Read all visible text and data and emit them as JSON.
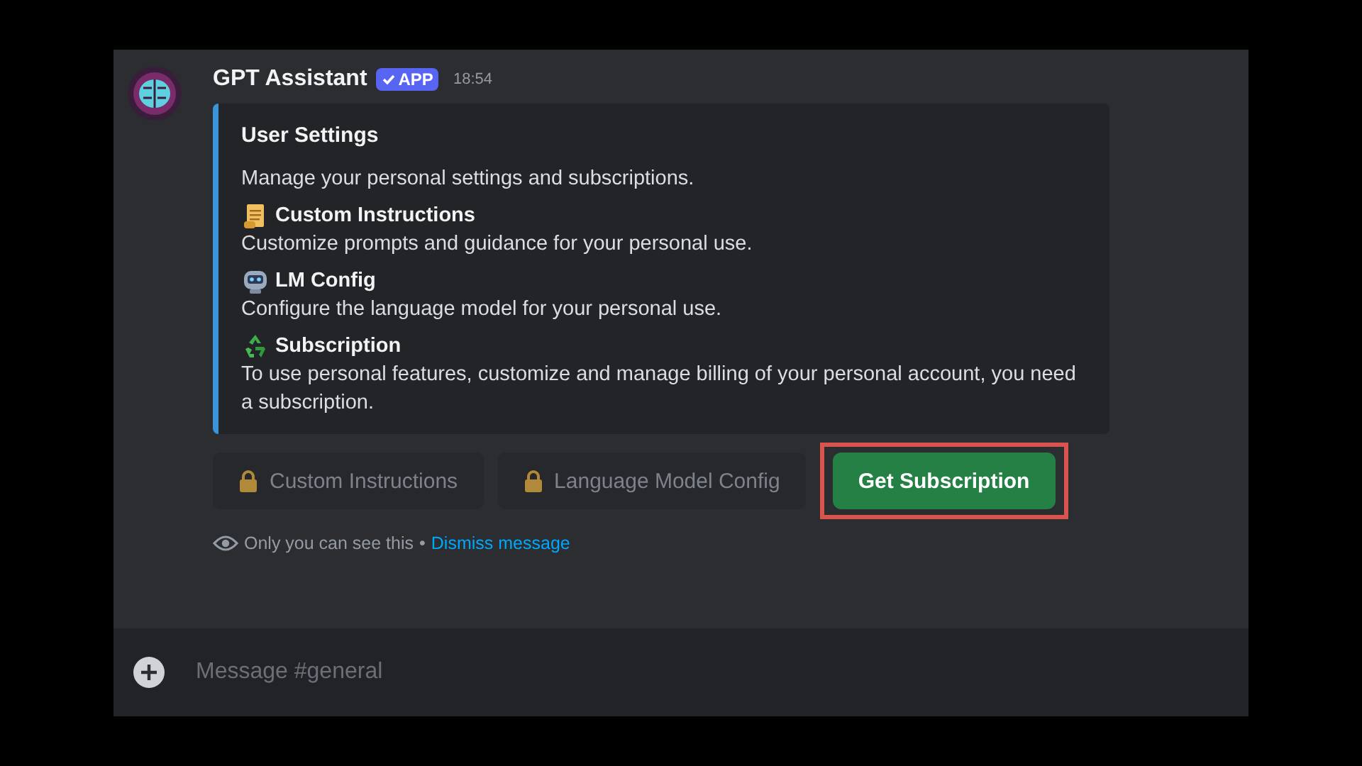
{
  "message": {
    "author": "GPT Assistant",
    "badge": "APP",
    "verified": true,
    "time": "18:54"
  },
  "embed": {
    "title": "User Settings",
    "description": "Manage your personal settings and subscriptions.",
    "sections": [
      {
        "heading": "Custom Instructions",
        "text": "Customize prompts and guidance for your personal use."
      },
      {
        "heading": "LM Config",
        "text": "Configure the language model for your personal use."
      },
      {
        "heading": "Subscription",
        "text": "To use personal features, customize and manage billing of your personal account, you need a subscription."
      }
    ]
  },
  "buttons": [
    {
      "label": "Custom Instructions",
      "disabled": true,
      "locked": true,
      "highlighted": false
    },
    {
      "label": "Language Model Config",
      "disabled": true,
      "locked": true,
      "highlighted": false
    },
    {
      "label": "Get Subscription",
      "disabled": false,
      "locked": false,
      "highlighted": true
    }
  ],
  "notice": {
    "text": "Only you can see this",
    "separator": "•",
    "link": "Dismiss message"
  },
  "composer": {
    "placeholder": "Message #general"
  }
}
